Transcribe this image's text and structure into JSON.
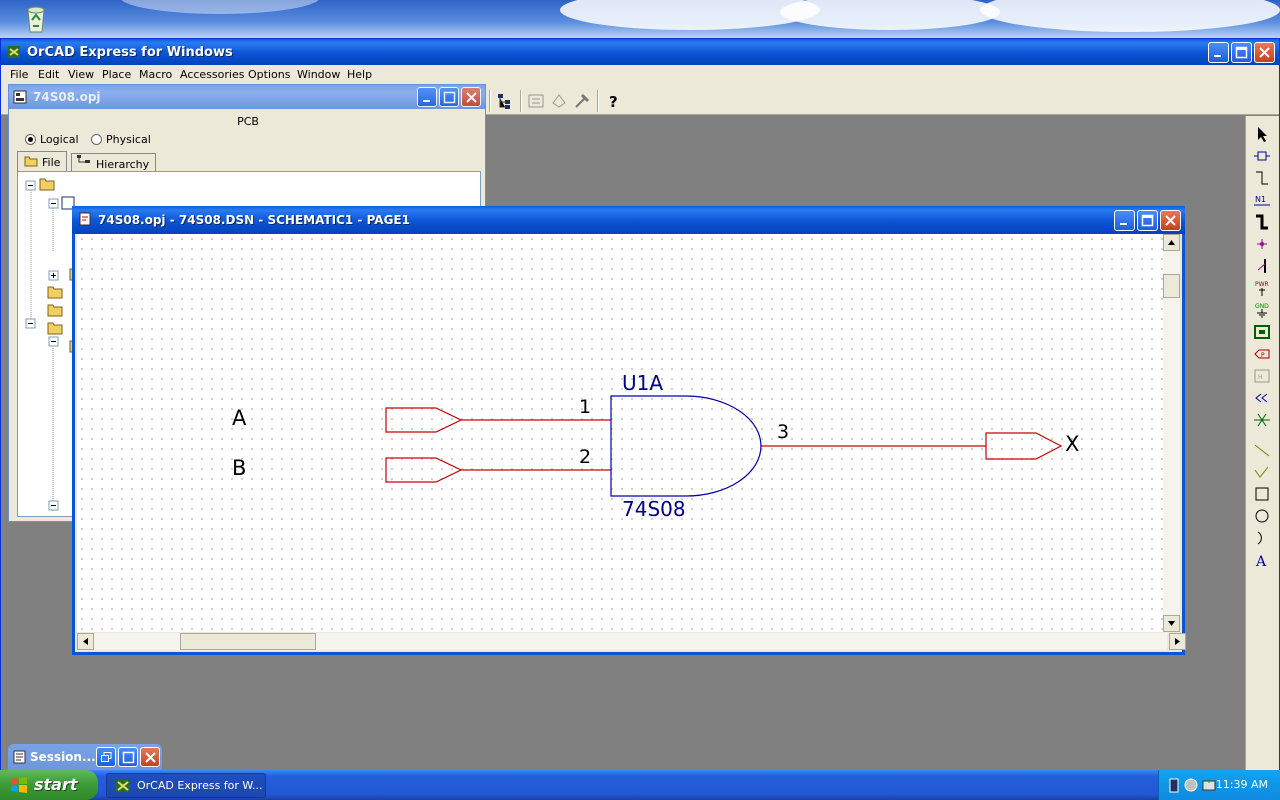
{
  "app": {
    "title": "OrCAD Express for Windows",
    "menu": [
      "File",
      "Edit",
      "View",
      "Place",
      "Macro",
      "Accessories",
      "Options",
      "Window",
      "Help"
    ]
  },
  "project_window": {
    "title": "74S08.opj",
    "group_label": "PCB",
    "radio_logical": "Logical",
    "radio_physical": "Physical",
    "selected_mode": "Logical",
    "tab_file": "File",
    "tab_hierarchy": "Hierarchy"
  },
  "schematic_window": {
    "title": "74S08.opj - 74S08.DSN - SCHEMATIC1 - PAGE1"
  },
  "schematic": {
    "part_ref": "U1A",
    "part_value": "74S08",
    "input_a_label": "A",
    "input_b_label": "B",
    "output_label": "X",
    "pin1": "1",
    "pin2": "2",
    "pin3": "3",
    "colors": {
      "part": "#00008b",
      "wire": "#cc0000",
      "port": "#cc0000",
      "text": "#000000"
    }
  },
  "session_window": {
    "title": "Session..."
  },
  "taskbar": {
    "start_label": "start",
    "task_label": "OrCAD Express for W...",
    "clock": "11:39 AM"
  }
}
